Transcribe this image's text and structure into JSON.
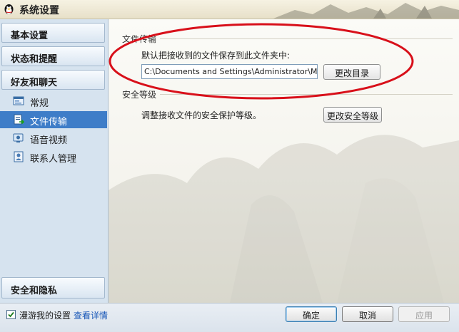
{
  "window": {
    "title": "系统设置",
    "icon": "penguin-icon"
  },
  "sidebar": {
    "sections": [
      {
        "label": "基本设置"
      },
      {
        "label": "状态和提醒"
      },
      {
        "label": "好友和聊天"
      }
    ],
    "items": [
      {
        "label": "常规",
        "icon": "chat-window-icon"
      },
      {
        "label": "文件传输",
        "icon": "file-transfer-icon",
        "selected": true
      },
      {
        "label": "语音视频",
        "icon": "video-icon"
      },
      {
        "label": "联系人管理",
        "icon": "contacts-icon"
      }
    ],
    "bottom_section": {
      "label": "安全和隐私"
    }
  },
  "file_transfer": {
    "heading": "文件传输",
    "description": "默认把接收到的文件保存到此文件夹中:",
    "path_value": "C:\\Documents and Settings\\Administrator\\My Documents",
    "change_dir_button": "更改目录"
  },
  "security_level": {
    "heading": "安全等级",
    "description": "调整接收文件的安全保护等级。",
    "change_button": "更改安全等级"
  },
  "footer": {
    "roam_label": "漫游我的设置",
    "roam_checked": true,
    "details_link": "查看详情",
    "ok_button": "确定",
    "cancel_button": "取消",
    "apply_button": "应用"
  },
  "colors": {
    "selected_bg": "#3e7dc8",
    "annotation_red": "#d8101a",
    "link": "#1a58b8"
  }
}
